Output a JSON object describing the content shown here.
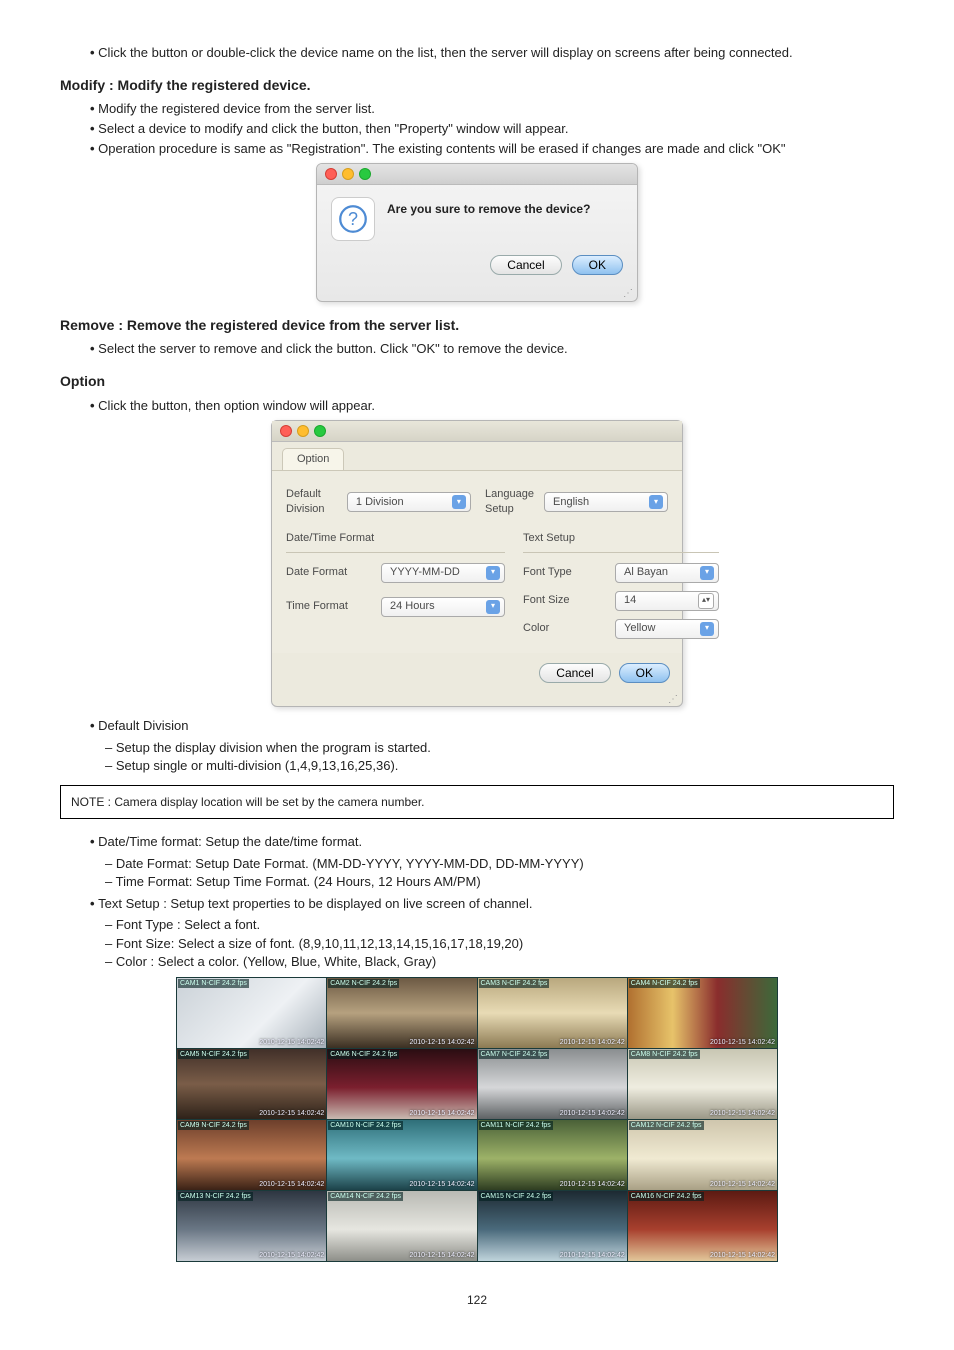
{
  "section_connect": {
    "bullets": [
      "Click the button or double-click the device name on the list, then the server will display on screens after being connected."
    ]
  },
  "section_modify": {
    "title": "Modify : Modify the registered device.",
    "bullets": [
      "Modify the registered device from the server list.",
      "Select a device to modify and click the button, then \"Property\" window will appear.",
      "Operation procedure is same as \"Registration\". The existing contents will be erased if changes are made and click \"OK\""
    ]
  },
  "dlg_remove": {
    "question": "Are you sure to remove the device?",
    "cancel": "Cancel",
    "ok": "OK"
  },
  "section_remove": {
    "title": "Remove : Remove the registered device from the server list.",
    "bullets": [
      "Select the server to remove and click the button. Click \"OK\" to remove the device."
    ]
  },
  "section_option": {
    "title": "Option",
    "bullets": [
      "Click the button, then option window will appear."
    ]
  },
  "opt_dialog": {
    "close": "⊗",
    "min": "⊖",
    "zoom": "⊕",
    "tab": "Option",
    "default_division_lbl": "Default Division",
    "default_division_val": "1 Division",
    "language_lbl": "Language Setup",
    "language_val": "English",
    "dtf_lbl": "Date/Time Format",
    "date_lbl": "Date Format",
    "date_val": "YYYY-MM-DD",
    "time_lbl": "Time Format",
    "time_val": "24 Hours",
    "text_lbl": "Text Setup",
    "font_type_lbl": "Font Type",
    "font_type_val": "Al Bayan",
    "font_size_lbl": "Font Size",
    "font_size_val": "14",
    "color_lbl": "Color",
    "color_val": "Yellow",
    "cancel": "Cancel",
    "ok": "OK"
  },
  "section_default_div": {
    "title": "Default Division",
    "sub": [
      "Setup the display division when the program is started.",
      "Setup single or multi-division (1,4,9,13,16,25,36)."
    ]
  },
  "note": "NOTE : Camera display location will be set by the camera number.",
  "section_dtf": {
    "title": "Date/Time format: Setup the date/time format.",
    "sub": [
      "Date Format: Setup Date Format. (MM-DD-YYYY, YYYY-MM-DD, DD-MM-YYYY)",
      "Time Format: Setup Time Format. (24 Hours, 12 Hours AM/PM)"
    ]
  },
  "section_text": {
    "title": "Text Setup : Setup text properties to be displayed on live screen of channel.",
    "sub": [
      "Font Type : Select a font.",
      "Font Size: Select a size of font. (8,9,10,11,12,13,14,15,16,17,18,19,20)",
      "Color : Select a color. (Yellow, Blue, White, Black, Gray)"
    ]
  },
  "cams": {
    "label_prefix": "CAM",
    "label_suffix": " N-CIF 24.2 fps",
    "ts": "2010-12-15  14:02:42",
    "scenes": [
      "linear-gradient(135deg,#cbd2d8,#eef1f4 60%,#a7b1ba)",
      "linear-gradient(#6d5a44,#b6a17f 50%,#3b2f22)",
      "linear-gradient(#b9a87e,#e8dbb5 50%,#8c7a53)",
      "linear-gradient(90deg,#b07030,#e7c36a 30%,#8a2d2d 60%,#3c6a3a)",
      "linear-gradient(#413029,#7a5d48 50%,#2e2219)",
      "linear-gradient(#2a0d12,#7b1f2e 55%,#c9b9b0)",
      "linear-gradient(#8a8e90,#d6d7d9 55%,#5e6264)",
      "linear-gradient(#c8c6b3,#efede0 55%,#9b9887)",
      "linear-gradient(#6d3f2b,#bd7a52 55%,#3b2216)",
      "linear-gradient(#2f6f79,#6fbac5 55%,#1c4249)",
      "linear-gradient(#4a6138,#9db268 55%,#2e3d21)",
      "linear-gradient(#cfc6ad,#f0ead2 55%,#a9a085)",
      "linear-gradient(#2e3641,#6a7785 55%,#c7cdd4)",
      "linear-gradient(#b9bab4,#e6e6e0 55%,#8e8f89)",
      "linear-gradient(#1d2a32,#4a6a7c 55%,#c0d4dc)",
      "linear-gradient(#5c1a12,#a8402e 55%,#e2c79a)"
    ]
  },
  "page": "122"
}
